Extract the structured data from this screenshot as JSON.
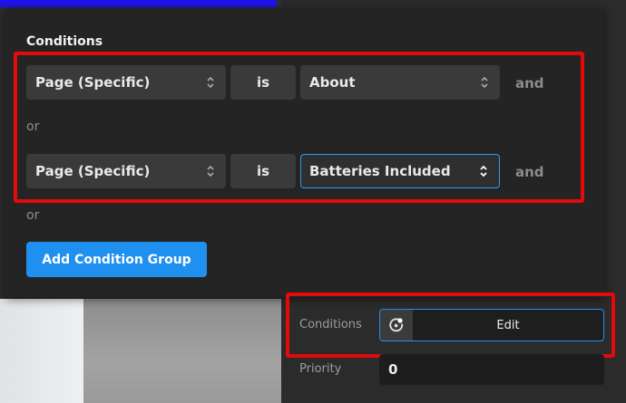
{
  "conditions": {
    "title": "Conditions",
    "groups": [
      {
        "field": "Page (Specific)",
        "operator": "is",
        "value": "About",
        "connector": "and"
      },
      {
        "field": "Page (Specific)",
        "operator": "is",
        "value": "Batteries Included",
        "connector": "and"
      }
    ],
    "or_labels": [
      "or",
      "or"
    ],
    "add_group_label": "Add Condition Group"
  },
  "right_panel": {
    "conditions_label": "Conditions",
    "edit_label": "Edit",
    "priority_label": "Priority",
    "priority_value": "0"
  },
  "colors": {
    "accent": "#1f8ff0",
    "highlight": "#e20a0a"
  }
}
